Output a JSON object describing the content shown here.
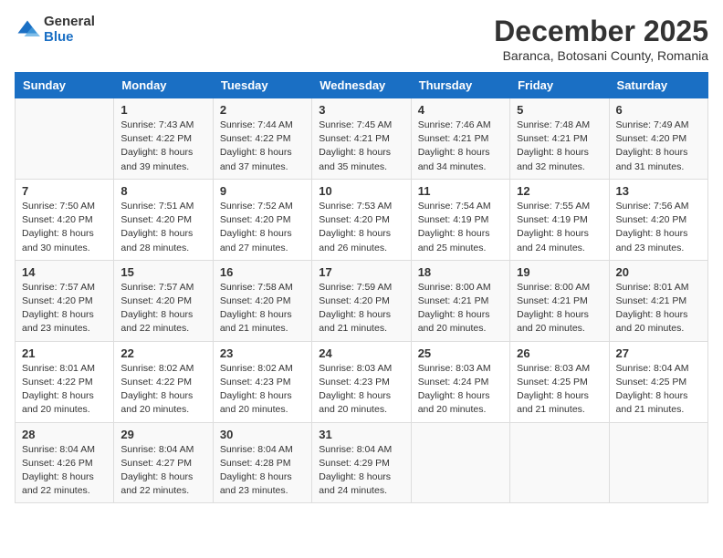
{
  "logo": {
    "general": "General",
    "blue": "Blue"
  },
  "title": "December 2025",
  "location": "Baranca, Botosani County, Romania",
  "headers": [
    "Sunday",
    "Monday",
    "Tuesday",
    "Wednesday",
    "Thursday",
    "Friday",
    "Saturday"
  ],
  "weeks": [
    [
      null,
      {
        "day": "1",
        "sunrise": "7:43 AM",
        "sunset": "4:22 PM",
        "daylight": "8 hours and 39 minutes."
      },
      {
        "day": "2",
        "sunrise": "7:44 AM",
        "sunset": "4:22 PM",
        "daylight": "8 hours and 37 minutes."
      },
      {
        "day": "3",
        "sunrise": "7:45 AM",
        "sunset": "4:21 PM",
        "daylight": "8 hours and 35 minutes."
      },
      {
        "day": "4",
        "sunrise": "7:46 AM",
        "sunset": "4:21 PM",
        "daylight": "8 hours and 34 minutes."
      },
      {
        "day": "5",
        "sunrise": "7:48 AM",
        "sunset": "4:21 PM",
        "daylight": "8 hours and 32 minutes."
      },
      {
        "day": "6",
        "sunrise": "7:49 AM",
        "sunset": "4:20 PM",
        "daylight": "8 hours and 31 minutes."
      }
    ],
    [
      {
        "day": "7",
        "sunrise": "7:50 AM",
        "sunset": "4:20 PM",
        "daylight": "8 hours and 30 minutes."
      },
      {
        "day": "8",
        "sunrise": "7:51 AM",
        "sunset": "4:20 PM",
        "daylight": "8 hours and 28 minutes."
      },
      {
        "day": "9",
        "sunrise": "7:52 AM",
        "sunset": "4:20 PM",
        "daylight": "8 hours and 27 minutes."
      },
      {
        "day": "10",
        "sunrise": "7:53 AM",
        "sunset": "4:20 PM",
        "daylight": "8 hours and 26 minutes."
      },
      {
        "day": "11",
        "sunrise": "7:54 AM",
        "sunset": "4:19 PM",
        "daylight": "8 hours and 25 minutes."
      },
      {
        "day": "12",
        "sunrise": "7:55 AM",
        "sunset": "4:19 PM",
        "daylight": "8 hours and 24 minutes."
      },
      {
        "day": "13",
        "sunrise": "7:56 AM",
        "sunset": "4:20 PM",
        "daylight": "8 hours and 23 minutes."
      }
    ],
    [
      {
        "day": "14",
        "sunrise": "7:57 AM",
        "sunset": "4:20 PM",
        "daylight": "8 hours and 23 minutes."
      },
      {
        "day": "15",
        "sunrise": "7:57 AM",
        "sunset": "4:20 PM",
        "daylight": "8 hours and 22 minutes."
      },
      {
        "day": "16",
        "sunrise": "7:58 AM",
        "sunset": "4:20 PM",
        "daylight": "8 hours and 21 minutes."
      },
      {
        "day": "17",
        "sunrise": "7:59 AM",
        "sunset": "4:20 PM",
        "daylight": "8 hours and 21 minutes."
      },
      {
        "day": "18",
        "sunrise": "8:00 AM",
        "sunset": "4:21 PM",
        "daylight": "8 hours and 20 minutes."
      },
      {
        "day": "19",
        "sunrise": "8:00 AM",
        "sunset": "4:21 PM",
        "daylight": "8 hours and 20 minutes."
      },
      {
        "day": "20",
        "sunrise": "8:01 AM",
        "sunset": "4:21 PM",
        "daylight": "8 hours and 20 minutes."
      }
    ],
    [
      {
        "day": "21",
        "sunrise": "8:01 AM",
        "sunset": "4:22 PM",
        "daylight": "8 hours and 20 minutes."
      },
      {
        "day": "22",
        "sunrise": "8:02 AM",
        "sunset": "4:22 PM",
        "daylight": "8 hours and 20 minutes."
      },
      {
        "day": "23",
        "sunrise": "8:02 AM",
        "sunset": "4:23 PM",
        "daylight": "8 hours and 20 minutes."
      },
      {
        "day": "24",
        "sunrise": "8:03 AM",
        "sunset": "4:23 PM",
        "daylight": "8 hours and 20 minutes."
      },
      {
        "day": "25",
        "sunrise": "8:03 AM",
        "sunset": "4:24 PM",
        "daylight": "8 hours and 20 minutes."
      },
      {
        "day": "26",
        "sunrise": "8:03 AM",
        "sunset": "4:25 PM",
        "daylight": "8 hours and 21 minutes."
      },
      {
        "day": "27",
        "sunrise": "8:04 AM",
        "sunset": "4:25 PM",
        "daylight": "8 hours and 21 minutes."
      }
    ],
    [
      {
        "day": "28",
        "sunrise": "8:04 AM",
        "sunset": "4:26 PM",
        "daylight": "8 hours and 22 minutes."
      },
      {
        "day": "29",
        "sunrise": "8:04 AM",
        "sunset": "4:27 PM",
        "daylight": "8 hours and 22 minutes."
      },
      {
        "day": "30",
        "sunrise": "8:04 AM",
        "sunset": "4:28 PM",
        "daylight": "8 hours and 23 minutes."
      },
      {
        "day": "31",
        "sunrise": "8:04 AM",
        "sunset": "4:29 PM",
        "daylight": "8 hours and 24 minutes."
      },
      null,
      null,
      null
    ]
  ]
}
